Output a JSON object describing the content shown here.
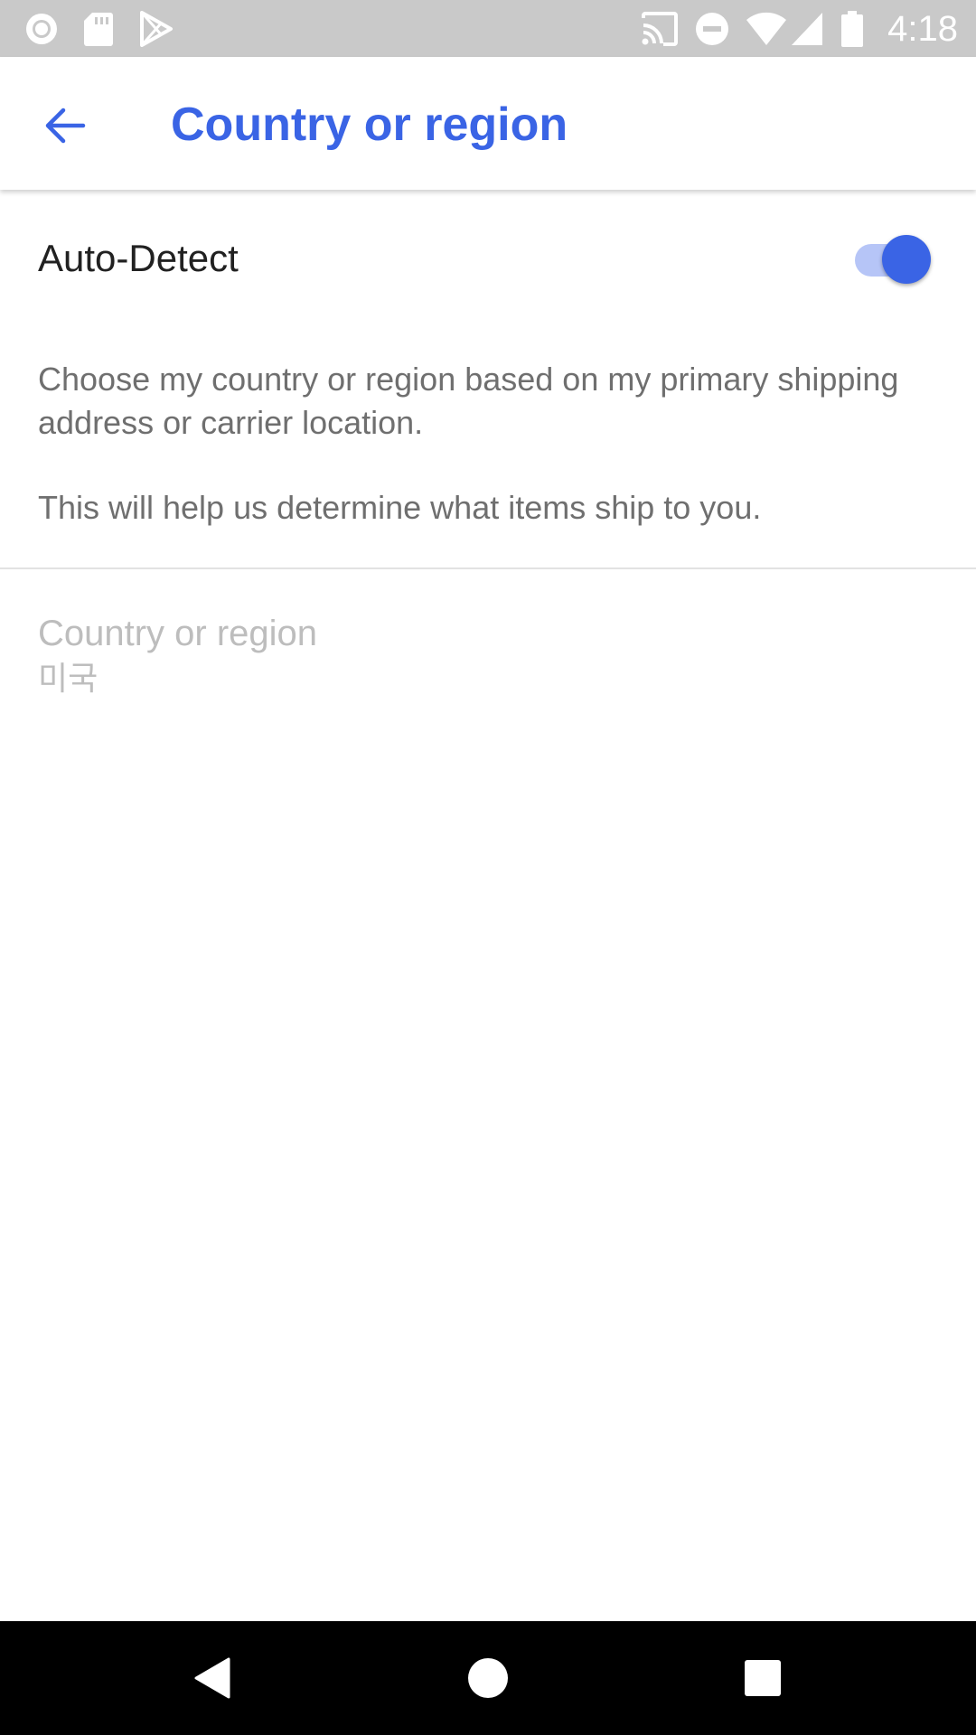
{
  "status_bar": {
    "time": "4:18",
    "left_icons": [
      "record-icon",
      "sd-card-icon",
      "play-store-icon"
    ],
    "right_icons": [
      "cast-icon",
      "do-not-disturb-icon",
      "wifi-icon",
      "signal-icon",
      "battery-icon"
    ]
  },
  "app_bar": {
    "title": "Country or region",
    "back_icon": "arrow-back-icon",
    "accent_color": "#3a64e5"
  },
  "auto_detect": {
    "label": "Auto-Detect",
    "enabled": true
  },
  "description": {
    "line1": "Choose my country or region based on my primary shipping address or carrier location.",
    "line2": "This will help us determine what items ship to you."
  },
  "country": {
    "label": "Country or region",
    "value": "미국"
  },
  "nav_bar": {
    "icons": [
      "back-triangle-icon",
      "home-circle-icon",
      "recents-square-icon"
    ]
  }
}
